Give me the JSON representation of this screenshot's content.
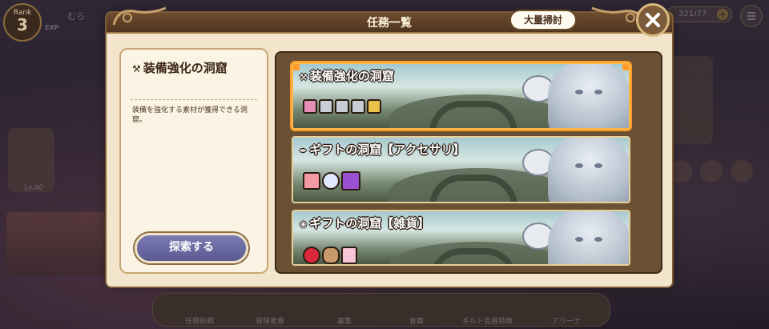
{
  "hud": {
    "rank_label": "Rank",
    "rank_value": "3",
    "player_name": "むら",
    "exp_label": "EXP",
    "stamina": "321/77",
    "stamina_plus": "+"
  },
  "dialog": {
    "title": "任務一覧",
    "bulk_sweep_label": "大量掃討",
    "close_icon": "close-x-icon"
  },
  "info": {
    "title": "装備強化の洞窟",
    "title_icon": "hammer-icon",
    "description": "装備を強化する素材が獲得できる洞窟。",
    "explore_label": "探索する"
  },
  "dungeons": [
    {
      "title": "装備強化の洞窟",
      "icon": "hammer-icon",
      "selected": true,
      "rewards": [
        "pink-hammer",
        "silver-hammer",
        "silver-hammer",
        "silver-hammer",
        "gold-hammer"
      ]
    },
    {
      "title": "ギフトの洞窟【アクセサリ】",
      "icon": "feather-icon",
      "selected": false,
      "rewards": [
        "flower-hairpin",
        "blue-ring",
        "purple-gem"
      ]
    },
    {
      "title": "ギフトの洞窟【雑貨】",
      "icon": "gift-icon",
      "selected": false,
      "rewards": [
        "red-rose",
        "teddy-bear",
        "perfume-bottle"
      ]
    }
  ],
  "background": {
    "side_level": "Lv.40",
    "nav": [
      "任務依頼",
      "冒険者寮",
      "募集",
      "倉庫",
      "ギルド会員特典",
      "アリーナ"
    ]
  },
  "colors": {
    "accent_orange": "#ff9b2a",
    "explore_button": "#6b6aa3",
    "dialog_bg": "#f2e5cc"
  }
}
